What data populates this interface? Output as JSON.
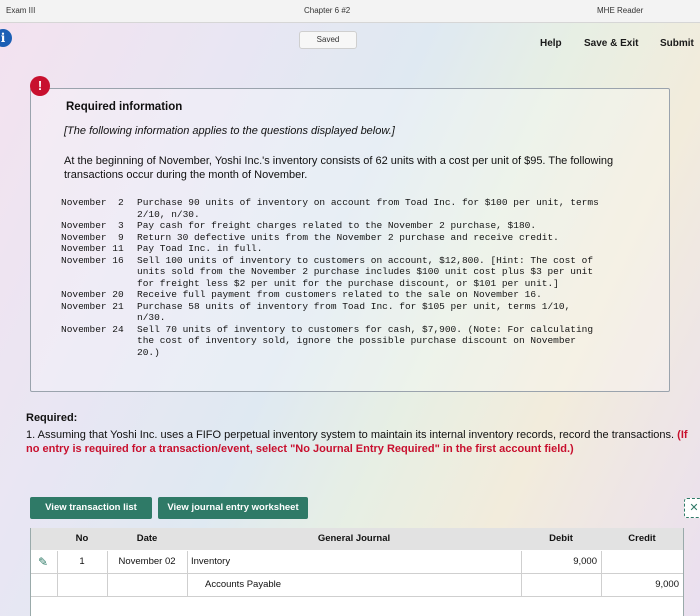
{
  "topbar": {
    "left": "Exam III",
    "center": "Chapter 6 #2",
    "right": "MHE Reader"
  },
  "status": {
    "saved": "Saved"
  },
  "nav": {
    "help": "Help",
    "save_exit": "Save & Exit",
    "submit": "Submit"
  },
  "required_info": {
    "title": "Required information",
    "subtitle": "[The following information applies to the questions displayed below.]",
    "intro": "At the beginning of November, Yoshi Inc.'s inventory consists of 62 units with a cost per unit of $95. The following transactions occur during the month of November.",
    "transactions": [
      {
        "date": "November  2",
        "lines": [
          "Purchase 90 units of inventory on account from Toad Inc. for $100 per unit, terms",
          "2/10, n/30."
        ]
      },
      {
        "date": "November  3",
        "lines": [
          "Pay cash for freight charges related to the November 2 purchase, $180."
        ]
      },
      {
        "date": "November  9",
        "lines": [
          "Return 30 defective units from the November 2 purchase and receive credit."
        ]
      },
      {
        "date": "November 11",
        "lines": [
          "Pay Toad Inc. in full."
        ]
      },
      {
        "date": "November 16",
        "lines": [
          "Sell 100 units of inventory to customers on account, $12,800. [Hint: The cost of",
          "units sold from the November 2 purchase includes $100 unit cost plus $3 per unit",
          "for freight less $2 per unit for the purchase discount, or $101 per unit.]"
        ]
      },
      {
        "date": "November 20",
        "lines": [
          "Receive full payment from customers related to the sale on November 16."
        ]
      },
      {
        "date": "November 21",
        "lines": [
          "Purchase 58 units of inventory from Toad Inc. for $105 per unit, terms 1/10,",
          "n/30."
        ]
      },
      {
        "date": "November 24",
        "lines": [
          "Sell 70 units of inventory to customers for cash, $7,900. (Note: For calculating",
          "the cost of inventory sold, ignore the possible purchase discount on November",
          "20.)"
        ]
      }
    ]
  },
  "required": {
    "label": "Required:",
    "text": "1. Assuming that Yoshi Inc. uses a FIFO perpetual inventory system to maintain its internal inventory records, record the transactions.",
    "note": "(If no entry is required for a transaction/event, select \"No Journal Entry Required\" in the first account field.)"
  },
  "buttons": {
    "view_transaction_list": "View transaction list",
    "view_journal_worksheet": "View journal entry worksheet"
  },
  "journal": {
    "headers": {
      "no": "No",
      "date": "Date",
      "general_journal": "General Journal",
      "debit": "Debit",
      "credit": "Credit"
    },
    "rows": [
      {
        "no": "1",
        "date": "November 02",
        "account": "Inventory",
        "debit": "9,000",
        "credit": ""
      },
      {
        "no": "",
        "date": "",
        "account": "Accounts Payable",
        "debit": "",
        "credit": "9,000"
      }
    ]
  }
}
